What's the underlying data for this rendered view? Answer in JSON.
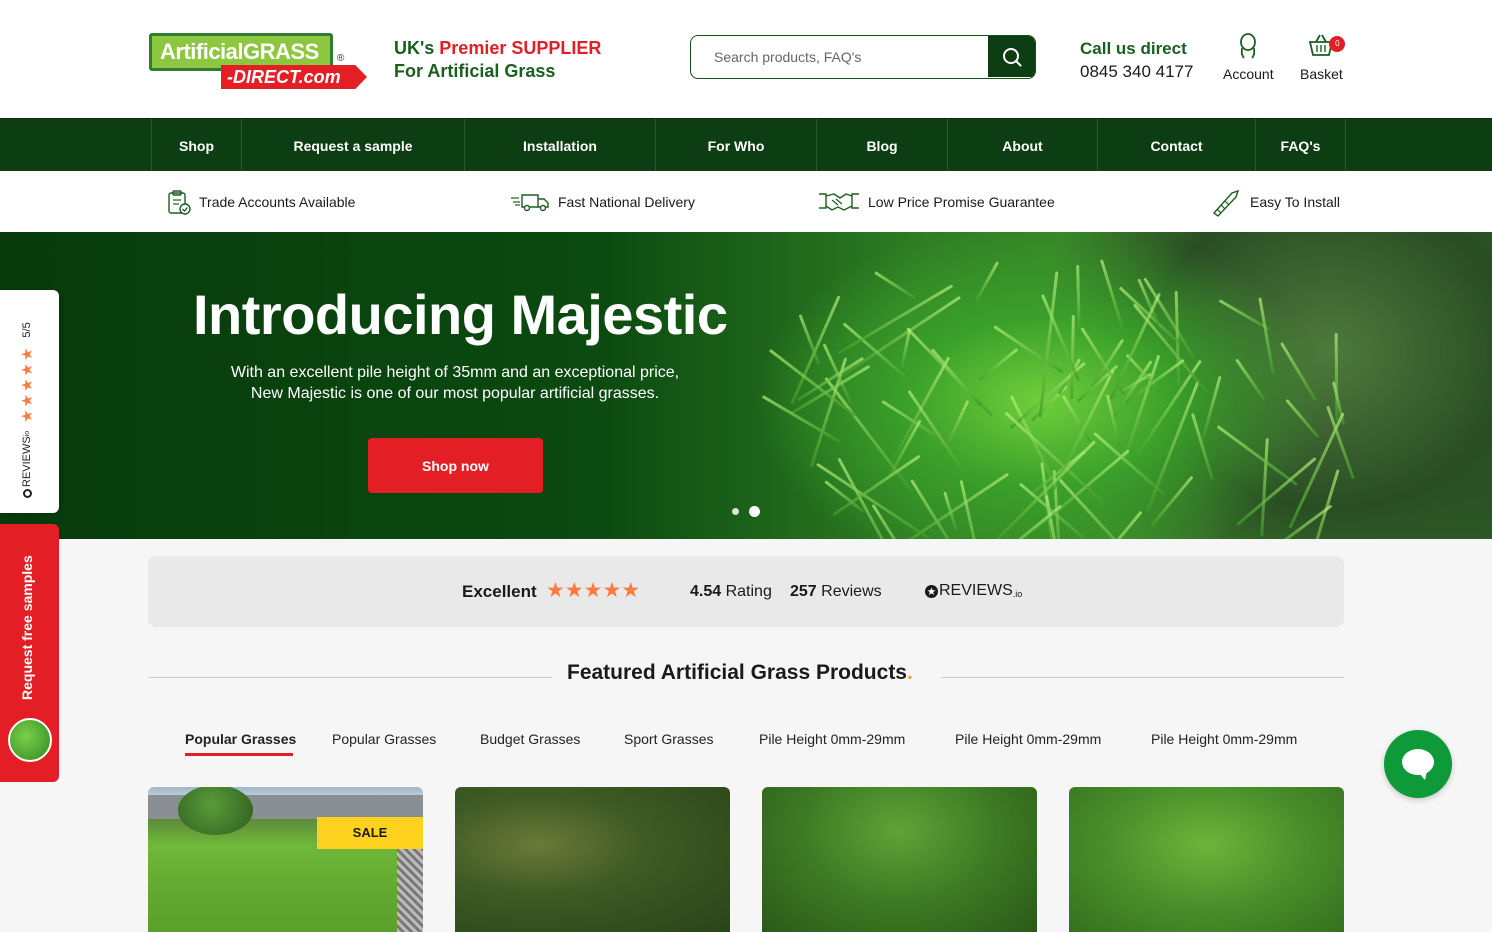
{
  "header": {
    "logo_top_a": "Artificial",
    "logo_top_b": "GRASS",
    "logo_bottom": "-DIRECT.com",
    "logo_reg": "®",
    "tagline_a": "UK's ",
    "tagline_b": "Premier SUPPLIER",
    "tagline_c": "For Artificial Grass",
    "search_placeholder": "Search products, FAQ's",
    "call_label": "Call us direct",
    "phone": "0845 340 4177",
    "account_label": "Account",
    "basket_label": "Basket",
    "basket_count": "0"
  },
  "nav": {
    "items": [
      "Shop",
      "Request a sample",
      "Installation",
      "For Who",
      "Blog",
      "About",
      "Contact",
      "FAQ's"
    ]
  },
  "usp": {
    "items": [
      "Trade Accounts Available",
      "Fast National Delivery",
      "Low Price Promise Guarantee",
      "Easy To Install"
    ]
  },
  "hero": {
    "title": "Introducing Majestic",
    "text_line1": "With an excellent pile height of 35mm and an exceptional price,",
    "text_line2": "New Majestic is one of our most popular artificial grasses.",
    "button": "Shop now",
    "slides": 2,
    "active_slide": 2
  },
  "side": {
    "reviews_score": "5/5",
    "reviews_brand": "REVIEWS",
    "reviews_brand_suffix": "io",
    "samples_label": "Request free samples"
  },
  "rating": {
    "excellent": "Excellent",
    "stars": "★★★★★",
    "score": "4.54",
    "score_label": "Rating",
    "count": "257",
    "count_label": "Reviews",
    "brand": "REVIEWS",
    "brand_suffix": ".io"
  },
  "featured": {
    "title": "Featured Artificial Grass Products",
    "title_dot": ".",
    "tabs": [
      "Popular Grasses",
      "Popular Grasses",
      "Budget Grasses",
      "Sport Grasses",
      "Pile Height 0mm-29mm",
      "Pile Height 0mm-29mm",
      "Pile Height 0mm-29mm"
    ],
    "active_tab": 0,
    "sale_badge": "SALE"
  },
  "colors": {
    "brand_green": "#0d3d12",
    "brand_red": "#e31e24",
    "star_orange": "#ff7a3d",
    "sale_yellow": "#ffd21f",
    "chat_green": "#0f9a3a"
  }
}
